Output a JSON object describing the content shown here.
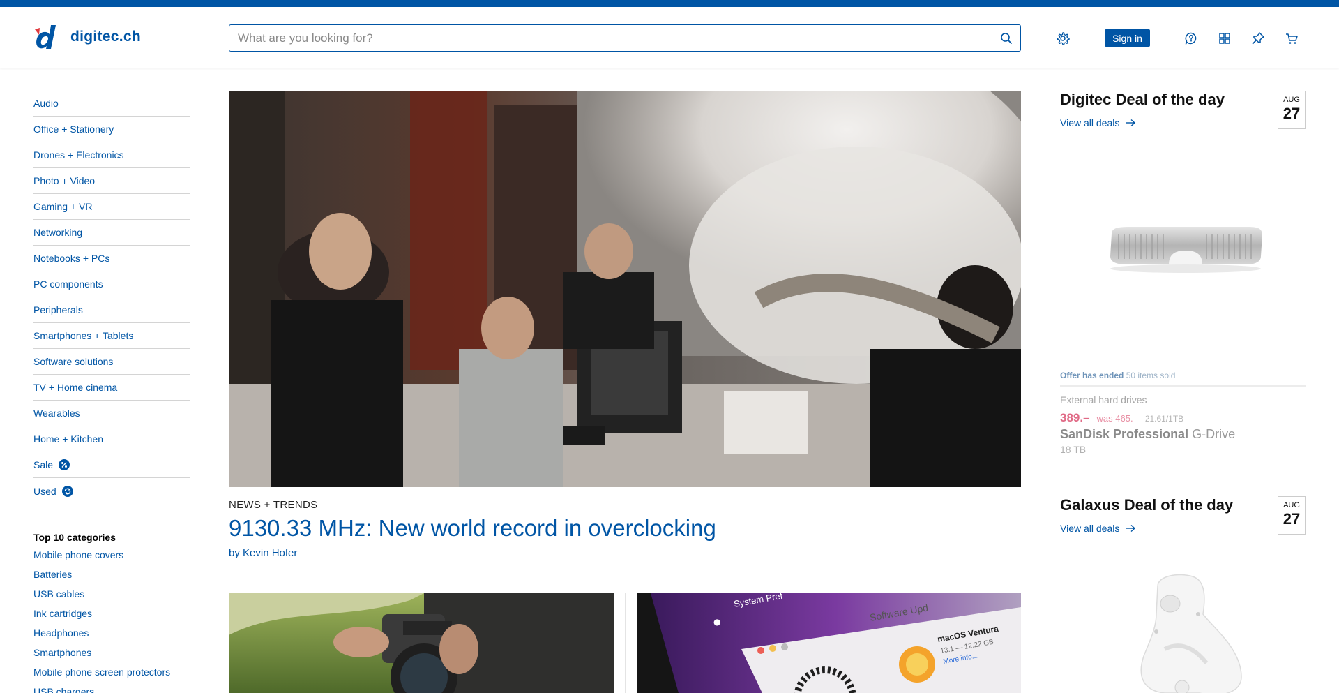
{
  "header": {
    "logo_text": "digitec.ch",
    "search_placeholder": "What are you looking for?",
    "signin_label": "Sign in",
    "icons": [
      "settings-icon",
      "help-icon",
      "apps-icon",
      "pin-icon",
      "cart-icon"
    ],
    "brand_color": "#0055a5"
  },
  "sidebar": {
    "categories": [
      "Audio",
      "Office + Stationery",
      "Drones + Electronics",
      "Photo + Video",
      "Gaming + VR",
      "Networking",
      "Notebooks + PCs",
      "PC components",
      "Peripherals",
      "Smartphones + Tablets",
      "Software solutions",
      "TV + Home cinema",
      "Wearables",
      "Home + Kitchen",
      "Sale",
      "Used"
    ],
    "top10_title": "Top 10 categories",
    "top10": [
      "Mobile phone covers",
      "Batteries",
      "USB cables",
      "Ink cartridges",
      "Headphones",
      "Smartphones",
      "Mobile phone screen protectors",
      "USB chargers"
    ]
  },
  "article": {
    "kicker": "NEWS + TRENDS",
    "headline": "9130.33 MHz: New world record in overclocking",
    "byline": "by Kevin Hofer"
  },
  "cards": {
    "card2_screen_title": "Software Upd",
    "card2_app_name": "macOS Ventura",
    "card2_app_version": "13.1 — 12.22 GB",
    "card2_more": "More info...",
    "card2_sys_pref": "System Pref"
  },
  "deal1": {
    "title": "Digitec Deal of the day",
    "link": "View all deals",
    "month": "AUG",
    "day": "27",
    "status_bold": "Offer has ended",
    "status_rest": "50 items sold",
    "category": "External hard drives",
    "price_now": "389.–",
    "price_was": "was 465.–",
    "price_unit": "21.61/1TB",
    "brand": "SanDisk Professional",
    "model": "G-Drive",
    "spec": "18 TB"
  },
  "deal2": {
    "title": "Galaxus Deal of the day",
    "link": "View all deals",
    "month": "AUG",
    "day": "27"
  }
}
